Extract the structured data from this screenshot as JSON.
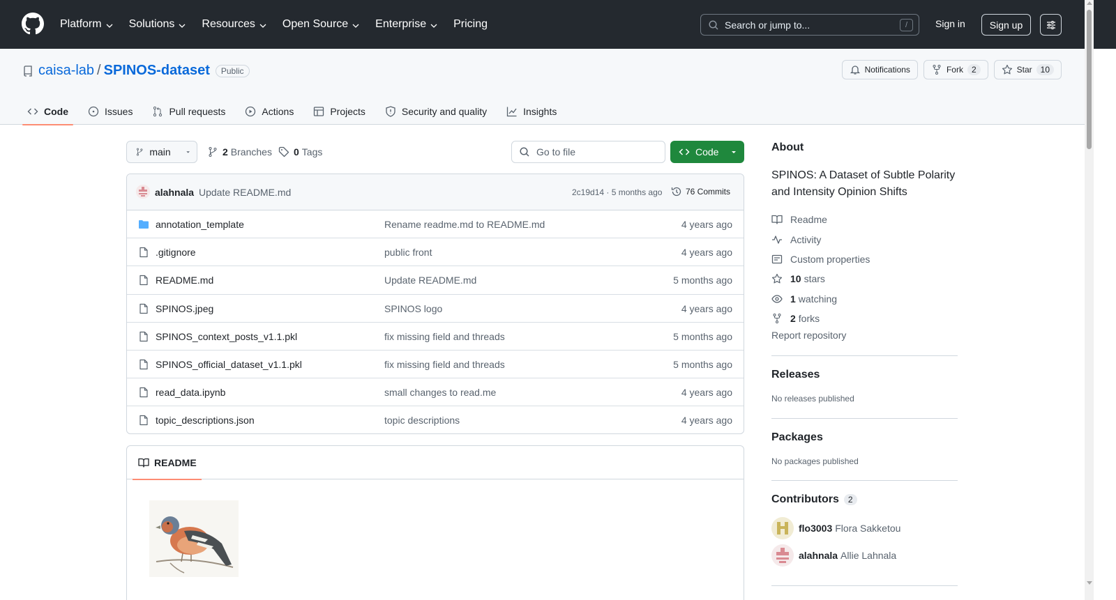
{
  "colors": {
    "header_bg": "#24292f",
    "link": "#0969da",
    "green_button": "#1f883d",
    "active_tab_underline": "#fd8c73",
    "folder": "#54aeff"
  },
  "header": {
    "nav": [
      {
        "label": "Platform",
        "icon": "chevron-down-icon"
      },
      {
        "label": "Solutions",
        "icon": "chevron-down-icon"
      },
      {
        "label": "Resources",
        "icon": "chevron-down-icon"
      },
      {
        "label": "Open Source",
        "icon": "chevron-down-icon"
      },
      {
        "label": "Enterprise",
        "icon": "chevron-down-icon"
      },
      {
        "label": "Pricing"
      }
    ],
    "search_placeholder": "Search or jump to...",
    "search_key": "/",
    "sign_in": "Sign in",
    "sign_up": "Sign up"
  },
  "repo": {
    "owner": "caisa-lab",
    "separator": "/",
    "name": "SPINOS-dataset",
    "visibility": "Public",
    "notifications_label": "Notifications",
    "fork_label": "Fork",
    "fork_count": "2",
    "star_label": "Star",
    "star_count": "10"
  },
  "tabs": [
    "Code",
    "Issues",
    "Pull requests",
    "Actions",
    "Projects",
    "Security and quality",
    "Insights"
  ],
  "toolbar": {
    "branch": "main",
    "branches_count": "2",
    "branches_label": "Branches",
    "tags_count": "0",
    "tags_label": "Tags",
    "goto_placeholder": "Go to file",
    "code_button": "Code"
  },
  "latest_commit": {
    "author": "alahnala",
    "message": "Update README.md",
    "hash_age": "2c19d14 · 5 months ago",
    "commits": "76 Commits"
  },
  "files": [
    {
      "name": "annotation_template",
      "type": "folder",
      "message": "Rename readme.md to README.md",
      "age": "4 years ago"
    },
    {
      "name": ".gitignore",
      "type": "file",
      "message": "public front",
      "age": "4 years ago"
    },
    {
      "name": "README.md",
      "type": "file",
      "message": "Update README.md",
      "age": "5 months ago"
    },
    {
      "name": "SPINOS.jpeg",
      "type": "file",
      "message": "SPINOS logo",
      "age": "4 years ago"
    },
    {
      "name": "SPINOS_context_posts_v1.1.pkl",
      "type": "file",
      "message": "fix missing field and threads",
      "age": "5 months ago"
    },
    {
      "name": "SPINOS_official_dataset_v1.1.pkl",
      "type": "file",
      "message": "fix missing field and threads",
      "age": "5 months ago"
    },
    {
      "name": "read_data.ipynb",
      "type": "file",
      "message": "small changes to read.me",
      "age": "4 years ago"
    },
    {
      "name": "topic_descriptions.json",
      "type": "file",
      "message": "topic descriptions",
      "age": "4 years ago"
    }
  ],
  "readme": {
    "tab_label": "README"
  },
  "about": {
    "title": "About",
    "description": "SPINOS: A Dataset of Subtle Polarity and Intensity Opinion Shifts",
    "readme": "Readme",
    "activity": "Activity",
    "custom_properties": "Custom properties",
    "stars_count": "10",
    "stars_label": "stars",
    "watching_count": "1",
    "watching_label": "watching",
    "forks_count": "2",
    "forks_label": "forks",
    "report": "Report repository"
  },
  "releases": {
    "title": "Releases",
    "text": "No releases published"
  },
  "packages": {
    "title": "Packages",
    "text": "No packages published"
  },
  "contributors": {
    "title": "Contributors",
    "count": "2",
    "list": [
      {
        "login": "flo3003",
        "name": "Flora Sakketou"
      },
      {
        "login": "alahnala",
        "name": "Allie Lahnala"
      }
    ]
  }
}
